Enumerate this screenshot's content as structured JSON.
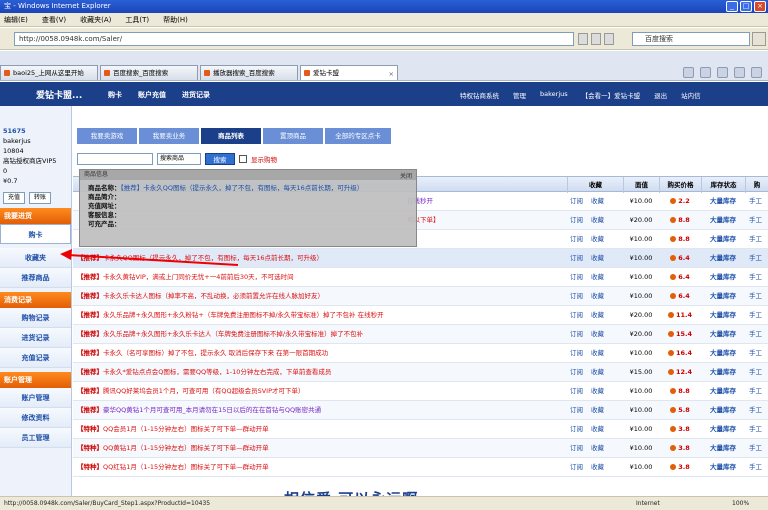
{
  "window": {
    "title": "宝 - Windows Internet Explorer"
  },
  "menu": [
    "编辑(E)",
    "查看(V)",
    "收藏夹(A)",
    "工具(T)",
    "帮助(H)"
  ],
  "address": {
    "url": "http://0058.0948k.com/Saler/",
    "search_placeholder": "百度搜索"
  },
  "tabs": [
    {
      "label": "baoi25_上网从这里开始"
    },
    {
      "label": "百度搜索_百度搜索"
    },
    {
      "label": "播放器搜索_百度搜索"
    },
    {
      "label": "爱钻卡盟",
      "active": true
    }
  ],
  "site": {
    "logo": "爱钻卡盟...",
    "nav": [
      "购卡",
      "账户充值",
      "进货记录"
    ],
    "right": [
      "特权钻商系统",
      "管理",
      "bakerjus",
      "【会看一】爱钻卡盟",
      "退出",
      "站内信"
    ]
  },
  "sidebar": {
    "user_lines": [
      "51675",
      "bakerjus",
      "10804",
      "高钻授权商店VIP5",
      "0",
      "¥0.7"
    ],
    "buttons": [
      "充值",
      "转账"
    ],
    "sections": [
      {
        "head": "我要进货",
        "items": [
          "购卡"
        ]
      },
      {
        "head": "",
        "items": [
          "收藏夹",
          "推荐商品"
        ]
      },
      {
        "head": "消费记录",
        "items": [
          "购物记录",
          "进货记录",
          "充值记录"
        ]
      },
      {
        "head": "账户管理",
        "items": [
          "账户管理",
          "修改资料",
          "员工管理"
        ]
      }
    ]
  },
  "subtabs": [
    "我要卖游戏",
    "我要卖业务",
    "商品列表",
    "置顶商品",
    "全部的专区点卡"
  ],
  "filter": {
    "select": "搜索商品",
    "button": "搜索",
    "check_label": "显示购物"
  },
  "table": {
    "headers": [
      "收藏",
      "面值",
      "购买价格",
      "库存状态",
      "购"
    ]
  },
  "popup": {
    "title": "商品信息",
    "close": "关闭",
    "lines": [
      {
        "label": "商品名称：",
        "value": "【推荐】卡永久QQ图标（提示永久，掉了不包，有图标，每天16点前长期，可升级）"
      },
      {
        "label": "商品简介：",
        "value": ""
      },
      {
        "label": "充值网址：",
        "value": ""
      },
      {
        "label": "客服信息：",
        "value": ""
      },
      {
        "label": "可充产品：",
        "value": ""
      }
    ]
  },
  "rows": [
    {
      "tag": "",
      "text": "",
      "color": "purple",
      "tail": "在线秒开",
      "act": [
        "订阅",
        "收藏"
      ],
      "face": "¥10.00",
      "price": "2.2",
      "stock": "大量库存",
      "mode": "手工"
    },
    {
      "tag": "",
      "text": "",
      "color": "red",
      "tail": "可以下单】",
      "act": [
        "订阅",
        "收藏"
      ],
      "face": "¥20.00",
      "price": "8.8",
      "stock": "大量库存",
      "mode": "手工"
    },
    {
      "tag": "",
      "text": "",
      "color": "red",
      "tail": "",
      "act": [
        "订阅",
        "收藏"
      ],
      "face": "¥10.00",
      "price": "8.8",
      "stock": "大量库存",
      "mode": "手工"
    },
    {
      "tag": "【推荐】",
      "text": "卡永久QQ图标（提示永久，掉了不包，有图标，每天16点前长期，可升级）",
      "color": "red",
      "tail": "",
      "act": [
        "订阅",
        "收藏"
      ],
      "face": "¥10.00",
      "price": "6.4",
      "stock": "大量库存",
      "mode": "手工"
    },
    {
      "tag": "【推荐】",
      "text": "卡永久黄钻VIP，满或上门同价无忧+一4前前后30天，不可选时间",
      "color": "red",
      "tail": "",
      "act": [
        "订阅",
        "收藏"
      ],
      "face": "¥10.00",
      "price": "6.4",
      "stock": "大量库存",
      "mode": "手工"
    },
    {
      "tag": "【推荐】",
      "text": "卡永久乐卡达人图标（掉率不高，不乱动换，必须前置允许在线人脉加好友）",
      "color": "red",
      "tail": "",
      "act": [
        "订阅",
        "收藏"
      ],
      "face": "¥10.00",
      "price": "6.4",
      "stock": "大量库存",
      "mode": "手工"
    },
    {
      "tag": "【推荐】",
      "text": "永久乐品牌+永久图形+永久粉钻+（车牌免费注册图标不掉/永久带宝标准）掉了不包补 在线秒开",
      "color": "red",
      "tail": "",
      "act": [
        "订阅",
        "收藏"
      ],
      "face": "¥20.00",
      "price": "11.4",
      "stock": "大量库存",
      "mode": "手工"
    },
    {
      "tag": "【推荐】",
      "text": "永久乐品牌+永久图形+永久乐卡达人（车牌免费注册图标不掉/永久带宝标准）掉了不包补",
      "color": "red",
      "tail": "",
      "act": [
        "订阅",
        "收藏"
      ],
      "face": "¥20.00",
      "price": "15.4",
      "stock": "大量库存",
      "mode": "手工"
    },
    {
      "tag": "【推荐】",
      "text": "卡永久（名可享图标）掉了不包，提示永久 取消后保存下来 在第一限首期成功",
      "color": "red",
      "tail": "",
      "act": [
        "订阅",
        "收藏"
      ],
      "face": "¥10.00",
      "price": "16.4",
      "stock": "大量库存",
      "mode": "手工"
    },
    {
      "tag": "【推荐】",
      "text": "卡永久*爱钻点点会Q图标，需要QQ等级，1-10分钟左右完成，下单前查看成员",
      "color": "red",
      "tail": "",
      "act": [
        "订阅",
        "收藏"
      ],
      "face": "¥15.00",
      "price": "12.4",
      "stock": "大量库存",
      "mode": "手工"
    },
    {
      "tag": "【推荐】",
      "text": "腾讯QQ好莱坞会员1个月，可查可用（有QQ超级会员SVIP才可下单）",
      "color": "red",
      "tail": "",
      "act": [
        "订阅",
        "收藏"
      ],
      "face": "¥10.00",
      "price": "8.8",
      "stock": "大量库存",
      "mode": "手工"
    },
    {
      "tag": "【推荐】",
      "text": "豪华QQ黄钻1个月可查可用_本月请勿在15日以后的在在首钻与QQ账密共通",
      "color": "purple",
      "tail": "",
      "act": [
        "订阅",
        "收藏"
      ],
      "face": "¥10.00",
      "price": "5.8",
      "stock": "大量库存",
      "mode": "手工"
    },
    {
      "tag": "【特种】",
      "text": "QQ会员1月（1-15分钟左右）图标关了可下单—群动开单",
      "color": "red",
      "tail": "",
      "act": [
        "订阅",
        "收藏"
      ],
      "face": "¥10.00",
      "price": "3.8",
      "stock": "大量库存",
      "mode": "手工"
    },
    {
      "tag": "【特种】",
      "text": "QQ黄钻1月（1-15分钟左右）图标关了可下单—群动开单",
      "color": "red",
      "tail": "",
      "act": [
        "订阅",
        "收藏"
      ],
      "face": "¥10.00",
      "price": "3.8",
      "stock": "大量库存",
      "mode": "手工"
    },
    {
      "tag": "【特种】",
      "text": "QQ红钻1月（1-15分钟左右）图标关了可下单—群动开单",
      "color": "red",
      "tail": "",
      "act": [
        "订阅",
        "收藏"
      ],
      "face": "¥10.00",
      "price": "3.8",
      "stock": "大量库存",
      "mode": "手工"
    }
  ],
  "status": {
    "text": "http://0058.0948k.com/Saler/BuyCard_Step1.aspx?ProductId=10435",
    "zone": "Internet",
    "zoom": "100%"
  },
  "caption": "相信爱 可以永远啊",
  "colors": {
    "nav": "#1c3f8a",
    "accent": "#e25e07",
    "link": "#1d4fa8",
    "tag": "#cc0000"
  }
}
